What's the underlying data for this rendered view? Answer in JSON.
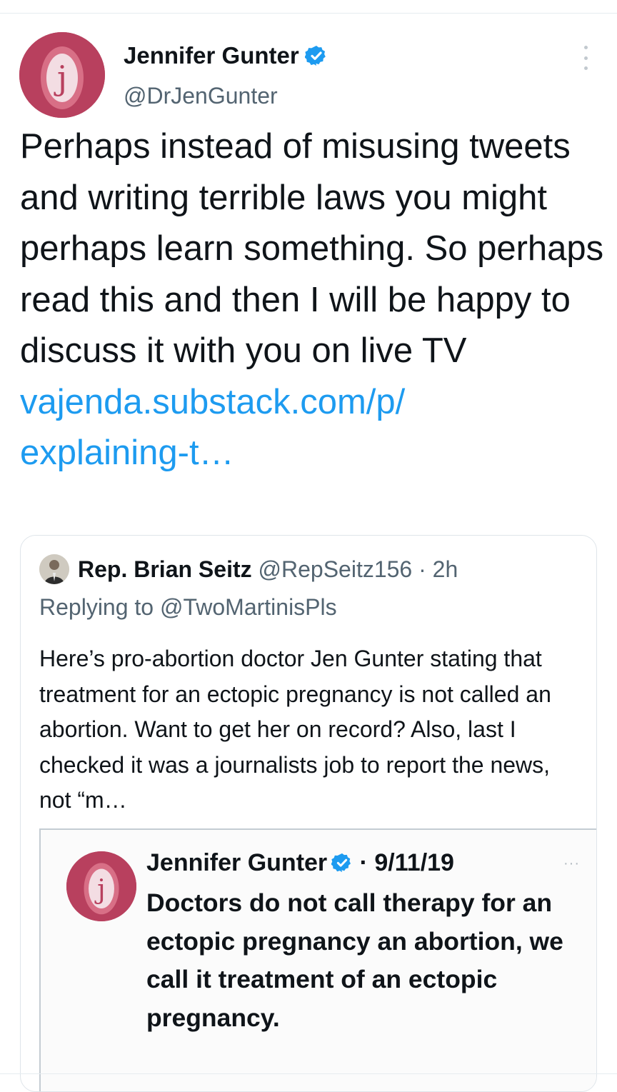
{
  "tweet": {
    "author_name": "Jennifer Gunter",
    "author_handle": "@DrJenGunter",
    "avatar_letter": "j",
    "verified_icon": "verified-badge-icon",
    "more_icon": "more-options-icon",
    "text": "Perhaps instead of misusing tweets and writing terrible laws you might perhaps learn something. So perhaps read this and then I will be happy to discuss it with you on live TV",
    "link_line1": "vajenda.substack.com/p/",
    "link_line2": "explaining-t…"
  },
  "quoted": {
    "author_name": "Rep. Brian Seitz",
    "meta": "@RepSeitz156 · 2h",
    "replying_to": "Replying to @TwoMartinisPls",
    "text": "Here’s pro-abortion doctor Jen Gunter stating that treatment for an ectopic pregnancy is not called an abortion. Want to get her on record? Also, last I checked it was a journalists job to report the news, not “m…"
  },
  "nested": {
    "author_name": "Jennifer Gunter",
    "date": "· 9/11/19",
    "more": "···",
    "avatar_letter": "j",
    "text": "Doctors do not call therapy for an ectopic pregnancy an abortion, we call it treatment of an ectopic pregnancy."
  },
  "colors": {
    "link": "#1d9bf0",
    "avatar": "#b8405e",
    "secondary_text": "#536471"
  }
}
